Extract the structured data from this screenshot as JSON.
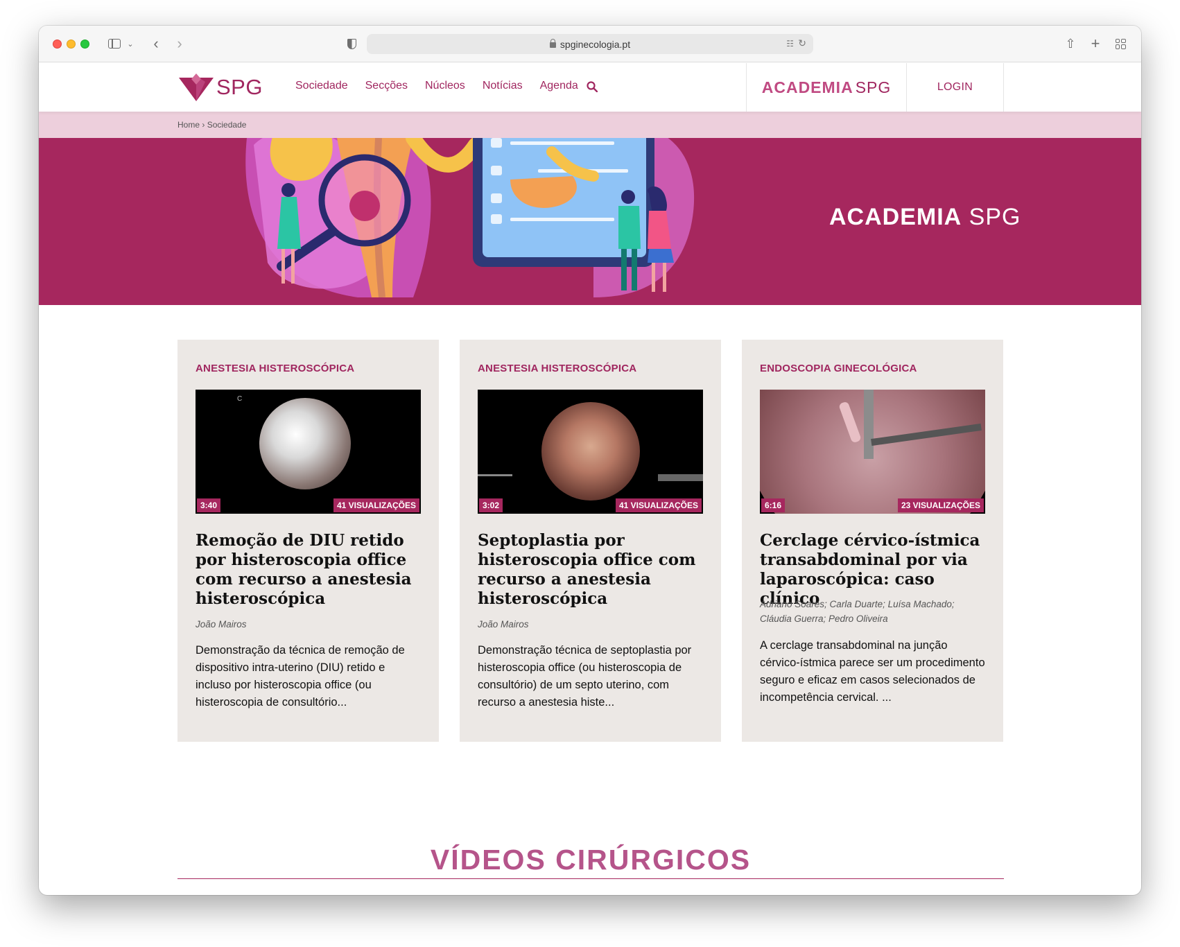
{
  "browser": {
    "url": "spginecologia.pt"
  },
  "site": {
    "logo_text": "SPG",
    "nav": [
      "Sociedade",
      "Secções",
      "Núcleos",
      "Notícias",
      "Agenda"
    ],
    "academia_part1": "ACADEMIA",
    "academia_part2": "SPG",
    "login": "LOGIN"
  },
  "breadcrumb": {
    "home": "Home",
    "separator": "›",
    "current": "Sociedade"
  },
  "hero": {
    "title_part1": "ACADEMIA",
    "title_part2": "SPG"
  },
  "cards": [
    {
      "category": "ANESTESIA HISTEROSCÓPICA",
      "duration": "3:40",
      "views": "41 VISUALIZAÇÕES",
      "title": "Remoção de DIU retido por histeroscopia office com recurso a anestesia histeroscópica",
      "author": "João Mairos",
      "description": "Demonstração da técnica de remoção de dispositivo intra-uterino (DIU) retido e incluso por histeroscopia office (ou histeroscopia de consultório..."
    },
    {
      "category": "ANESTESIA HISTEROSCÓPICA",
      "duration": "3:02",
      "views": "41 VISUALIZAÇÕES",
      "title": "Septoplastia por histeroscopia office com recurso a anestesia histeroscópica",
      "author": "João Mairos",
      "description": "Demonstração técnica de septoplastia por histeroscopia office (ou histeroscopia de consultório) de um septo uterino, com recurso a anestesia histe..."
    },
    {
      "category": "ENDOSCOPIA GINECOLÓGICA",
      "duration": "6:16",
      "views": "23 VISUALIZAÇÕES",
      "title": "Cerclage cérvico-ístmica transabdominal por via laparoscópica: caso clínico",
      "author": "Adriano Soares; Carla Duarte; Luísa Machado; Cláudia Guerra; Pedro Oliveira",
      "description": "A cerclage transabdominal na junção cérvico-ístmica parece ser um procedimento seguro e eficaz em casos selecionados de incompetência cervical. ..."
    }
  ],
  "section": {
    "title": "VÍDEOS CIRÚRGICOS"
  },
  "colors": {
    "brand": "#a6275e",
    "brand_light": "#edcfdc",
    "card_bg": "#ece8e5"
  }
}
